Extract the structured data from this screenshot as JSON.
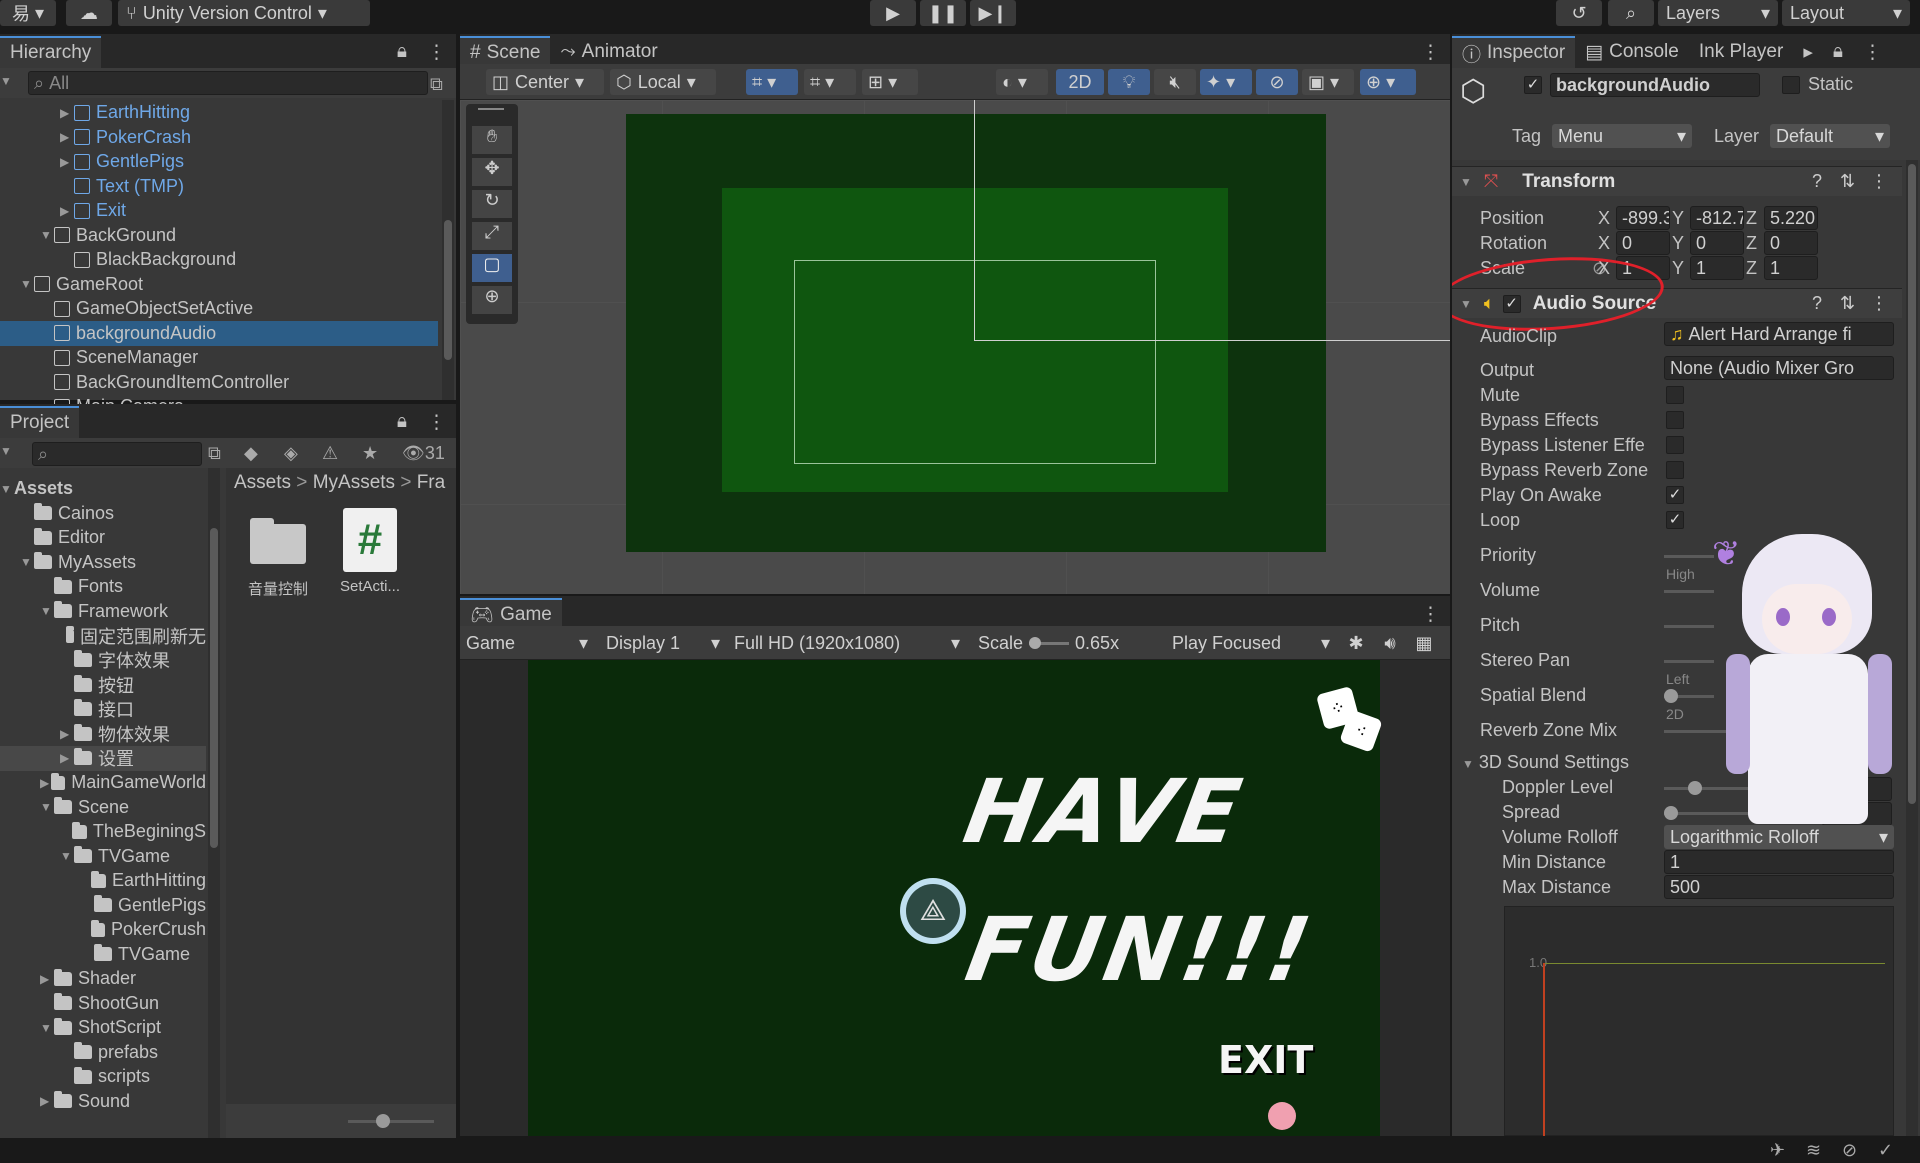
{
  "topbar": {
    "left_label": "易",
    "vc_label": "Unity Version Control",
    "layers": "Layers",
    "layout": "Layout"
  },
  "hierarchy": {
    "title": "Hierarchy",
    "search_placeholder": "All",
    "items": [
      {
        "label": "EarthHitting",
        "indent": 4,
        "arrow": "▶",
        "blue": true,
        "icon": "cube"
      },
      {
        "label": "PokerCrash",
        "indent": 4,
        "arrow": "▶",
        "blue": true,
        "icon": "cube"
      },
      {
        "label": "GentlePigs",
        "indent": 4,
        "arrow": "▶",
        "blue": true,
        "icon": "cube"
      },
      {
        "label": "Text (TMP)",
        "indent": 4,
        "arrow": "",
        "blue": true,
        "icon": "cube"
      },
      {
        "label": "Exit",
        "indent": 4,
        "arrow": "▶",
        "blue": true,
        "icon": "cube"
      },
      {
        "label": "BackGround",
        "indent": 3,
        "arrow": "▼",
        "blue": false,
        "icon": "cube"
      },
      {
        "label": "BlackBackground",
        "indent": 4,
        "arrow": "",
        "blue": false,
        "icon": "cube"
      },
      {
        "label": "GameRoot",
        "indent": 2,
        "arrow": "▼",
        "blue": false,
        "icon": "cube"
      },
      {
        "label": "GameObjectSetActive",
        "indent": 3,
        "arrow": "",
        "blue": false,
        "icon": "cube"
      },
      {
        "label": "backgroundAudio",
        "indent": 3,
        "arrow": "",
        "blue": false,
        "icon": "cube",
        "selected": true
      },
      {
        "label": "SceneManager",
        "indent": 3,
        "arrow": "",
        "blue": false,
        "icon": "cube"
      },
      {
        "label": "BackGroundItemController",
        "indent": 3,
        "arrow": "",
        "blue": false,
        "icon": "cube"
      },
      {
        "label": "Main Camera",
        "indent": 3,
        "arrow": "",
        "blue": false,
        "icon": "cube"
      }
    ]
  },
  "project": {
    "title": "Project",
    "count": "31",
    "tree": [
      {
        "label": "Assets",
        "indent": 0,
        "arrow": "▼",
        "bold": true
      },
      {
        "label": "Cainos",
        "indent": 1,
        "arrow": ""
      },
      {
        "label": "Editor",
        "indent": 1,
        "arrow": ""
      },
      {
        "label": "MyAssets",
        "indent": 1,
        "arrow": "▼"
      },
      {
        "label": "Fonts",
        "indent": 2,
        "arrow": ""
      },
      {
        "label": "Framework",
        "indent": 2,
        "arrow": "▼"
      },
      {
        "label": "固定范围刷新无",
        "indent": 3,
        "arrow": ""
      },
      {
        "label": "字体效果",
        "indent": 3,
        "arrow": ""
      },
      {
        "label": "按钮",
        "indent": 3,
        "arrow": ""
      },
      {
        "label": "接口",
        "indent": 3,
        "arrow": ""
      },
      {
        "label": "物体效果",
        "indent": 3,
        "arrow": "▶"
      },
      {
        "label": "设置",
        "indent": 3,
        "arrow": "▶",
        "highlight": true
      },
      {
        "label": "MainGameWorld",
        "indent": 2,
        "arrow": "▶"
      },
      {
        "label": "Scene",
        "indent": 2,
        "arrow": "▼"
      },
      {
        "label": "TheBeginingS",
        "indent": 3,
        "arrow": ""
      },
      {
        "label": "TVGame",
        "indent": 3,
        "arrow": "▼"
      },
      {
        "label": "EarthHitting",
        "indent": 4,
        "arrow": ""
      },
      {
        "label": "GentlePigs",
        "indent": 4,
        "arrow": ""
      },
      {
        "label": "PokerCrush",
        "indent": 4,
        "arrow": ""
      },
      {
        "label": "TVGame",
        "indent": 4,
        "arrow": ""
      },
      {
        "label": "Shader",
        "indent": 2,
        "arrow": "▶"
      },
      {
        "label": "ShootGun",
        "indent": 2,
        "arrow": ""
      },
      {
        "label": "ShotScript",
        "indent": 2,
        "arrow": "▼"
      },
      {
        "label": "prefabs",
        "indent": 3,
        "arrow": ""
      },
      {
        "label": "scripts",
        "indent": 3,
        "arrow": ""
      },
      {
        "label": "Sound",
        "indent": 2,
        "arrow": "▶"
      }
    ],
    "breadcrumb": [
      "Assets",
      "MyAssets",
      "Fra"
    ],
    "files": [
      {
        "label": "音量控制",
        "type": "folder"
      },
      {
        "label": "SetActi...",
        "type": "script"
      }
    ]
  },
  "scene": {
    "tab_scene": "Scene",
    "tab_animator": "Animator",
    "center": "Center",
    "local": "Local",
    "btn_2d": "2D"
  },
  "game": {
    "tab": "Game",
    "mode": "Game",
    "display": "Display 1",
    "resolution": "Full HD (1920x1080)",
    "scale_label": "Scale",
    "scale_value": "0.65x",
    "play_focused": "Play Focused",
    "title_line1": "HAVE",
    "title_line2": "FUN!!!",
    "exit": "EXIT"
  },
  "inspector": {
    "tab_inspector": "Inspector",
    "tab_console": "Console",
    "tab_ink": "Ink Player",
    "object_name": "backgroundAudio",
    "static": "Static",
    "tag_label": "Tag",
    "tag_value": "Menu",
    "layer_label": "Layer",
    "layer_value": "Default",
    "transform": {
      "title": "Transform",
      "position_label": "Position",
      "rotation_label": "Rotation",
      "scale_label": "Scale",
      "position": [
        "-899.3",
        "-812.7",
        "5.220"
      ],
      "rotation": [
        "0",
        "0",
        "0"
      ],
      "scale": [
        "1",
        "1",
        "1"
      ]
    },
    "audio": {
      "title": "Audio Source",
      "audioclip_label": "AudioClip",
      "audioclip_value": "Alert Hard Arrange fi",
      "output_label": "Output",
      "output_value": "None (Audio Mixer Gro",
      "mute": "Mute",
      "bypass_effects": "Bypass Effects",
      "bypass_listener": "Bypass Listener Effe",
      "bypass_reverb": "Bypass Reverb Zone",
      "play_on_awake": "Play On Awake",
      "loop": "Loop",
      "priority": "Priority",
      "priority_hint": "High",
      "volume": "Volume",
      "pitch": "Pitch",
      "stereo_pan": "Stereo Pan",
      "stereo_hint": "Left",
      "spatial_blend": "Spatial Blend",
      "spatial_hint": "2D",
      "reverb_mix": "Reverb Zone Mix",
      "reverb_value": "1",
      "sound3d": "3D Sound Settings",
      "doppler": "Doppler Level",
      "doppler_value": "1",
      "spread": "Spread",
      "spread_value": "0",
      "rolloff": "Volume Rolloff",
      "rolloff_value": "Logarithmic Rolloff",
      "min_distance": "Min Distance",
      "min_value": "1",
      "max_distance": "Max Distance",
      "max_value": "500",
      "graph_label": "1.0"
    }
  },
  "colors": {
    "accent": "#4a8fd8",
    "selection": "#2c5d87",
    "annotation": "#e0202a",
    "game_bg": "#0a2a0a"
  }
}
